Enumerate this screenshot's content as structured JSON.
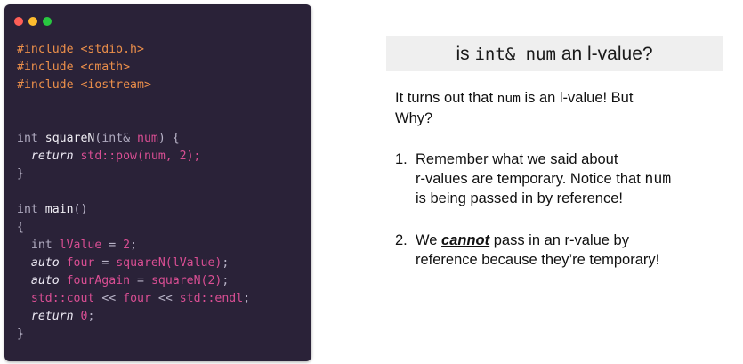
{
  "window": {
    "dots": [
      {
        "name": "close-dot",
        "color": "#ff5f57"
      },
      {
        "name": "minimize-dot",
        "color": "#febc2e"
      },
      {
        "name": "zoom-dot",
        "color": "#28c840"
      }
    ]
  },
  "colors": {
    "code_background": "#2a2238",
    "preprocessor": "#ec8f4a",
    "variable": "#d94e93",
    "title_background": "#efefef"
  },
  "code": {
    "inc1_kw": "#include",
    "inc1_arg": "<stdio.h>",
    "inc2_kw": "#include",
    "inc2_arg": "<cmath>",
    "inc3_kw": "#include",
    "inc3_arg": "<iostream>",
    "sq_type": "int",
    "sq_name": "squareN",
    "sq_open": "(",
    "sq_ptype": "int&",
    "sq_param": "num",
    "sq_close": ") {",
    "pow_return": "return",
    "pow_call": "std::pow(num,",
    "pow_arg": "2",
    "pow_end": ");",
    "brace_close_1": "}",
    "main_type": "int",
    "main_name": "main",
    "main_parens": "()",
    "brace_open_2": "{",
    "lv_type": "int",
    "lv_name": "lValue",
    "lv_eq": "=",
    "lv_val": "2",
    "lv_end": ";",
    "four_kw": "auto",
    "four_name": "four",
    "four_eq": "=",
    "four_call": "squareN(lValue)",
    "four_end": ";",
    "fa_kw": "auto",
    "fa_name": "fourAgain",
    "fa_eq": "=",
    "fa_call": "squareN(2)",
    "fa_end": ";",
    "cout_obj": "std::cout",
    "cout_op1": "<<",
    "cout_var": "four",
    "cout_op2": "<<",
    "cout_endl": "std::endl",
    "cout_end": ";",
    "ret_kw": "return",
    "ret_val": "0",
    "ret_end": ";",
    "brace_close_2": "}"
  },
  "slide": {
    "title_pre": "is",
    "title_code": "int& num",
    "title_post": "an l-value?",
    "intro_1": "It turns out that",
    "intro_code": "num",
    "intro_2": "is an l-value! But",
    "intro_3": "Why?",
    "item1_marker": "1.",
    "item1_line1": "Remember what we said about",
    "item1_line2a": "r-values are temporary. Notice that",
    "item1_code": "num",
    "item1_line3": "is being passed in by reference!",
    "item2_marker": "2.",
    "item2_we": "We",
    "item2_em": "cannot",
    "item2_rest": "pass in an r-value by",
    "item2_line2": "reference because they’re temporary!"
  }
}
